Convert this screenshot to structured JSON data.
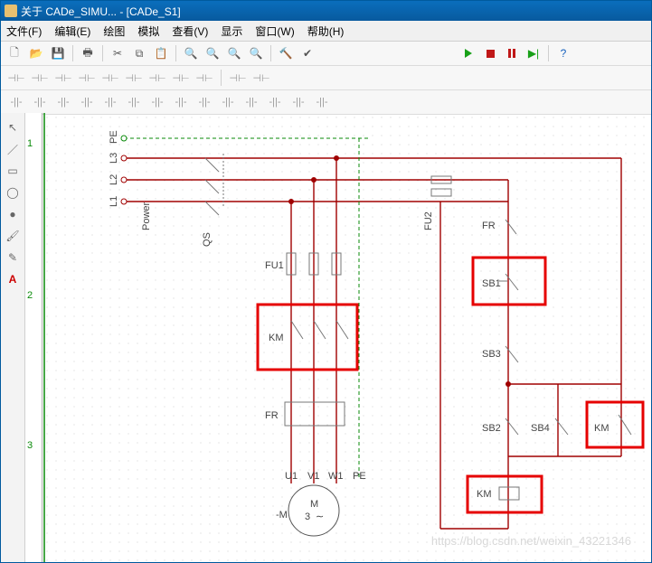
{
  "title": "关于 CADe_SIMU... - [CADe_S1]",
  "menu": {
    "file": "文件(F)",
    "edit": "编辑(E)",
    "draw": "绘图",
    "sim": "模拟",
    "view": "查看(V)",
    "display": "显示",
    "window": "窗口(W)",
    "help": "帮助(H)"
  },
  "ruler": {
    "m1": "1",
    "m2": "2",
    "m3": "3"
  },
  "labels": {
    "PE": "PE",
    "L3": "L3",
    "L2": "L2",
    "L1": "L1",
    "Power": "Power",
    "QS": "QS",
    "FU1": "FU1",
    "FU2": "FU2",
    "FR": "FR",
    "FR2": "FR",
    "KM": "KM",
    "KM2": "KM",
    "KM3": "KM",
    "SB1": "SB1",
    "SB2": "SB2",
    "SB3": "SB3",
    "SB4": "SB4",
    "U1": "U1",
    "V1": "V1",
    "W1": "W1",
    "PE2": "PE",
    "M": "M",
    "M3": "3",
    "minusM": "-M"
  },
  "watermark": "https://blog.csdn.net/weixin_43221346"
}
